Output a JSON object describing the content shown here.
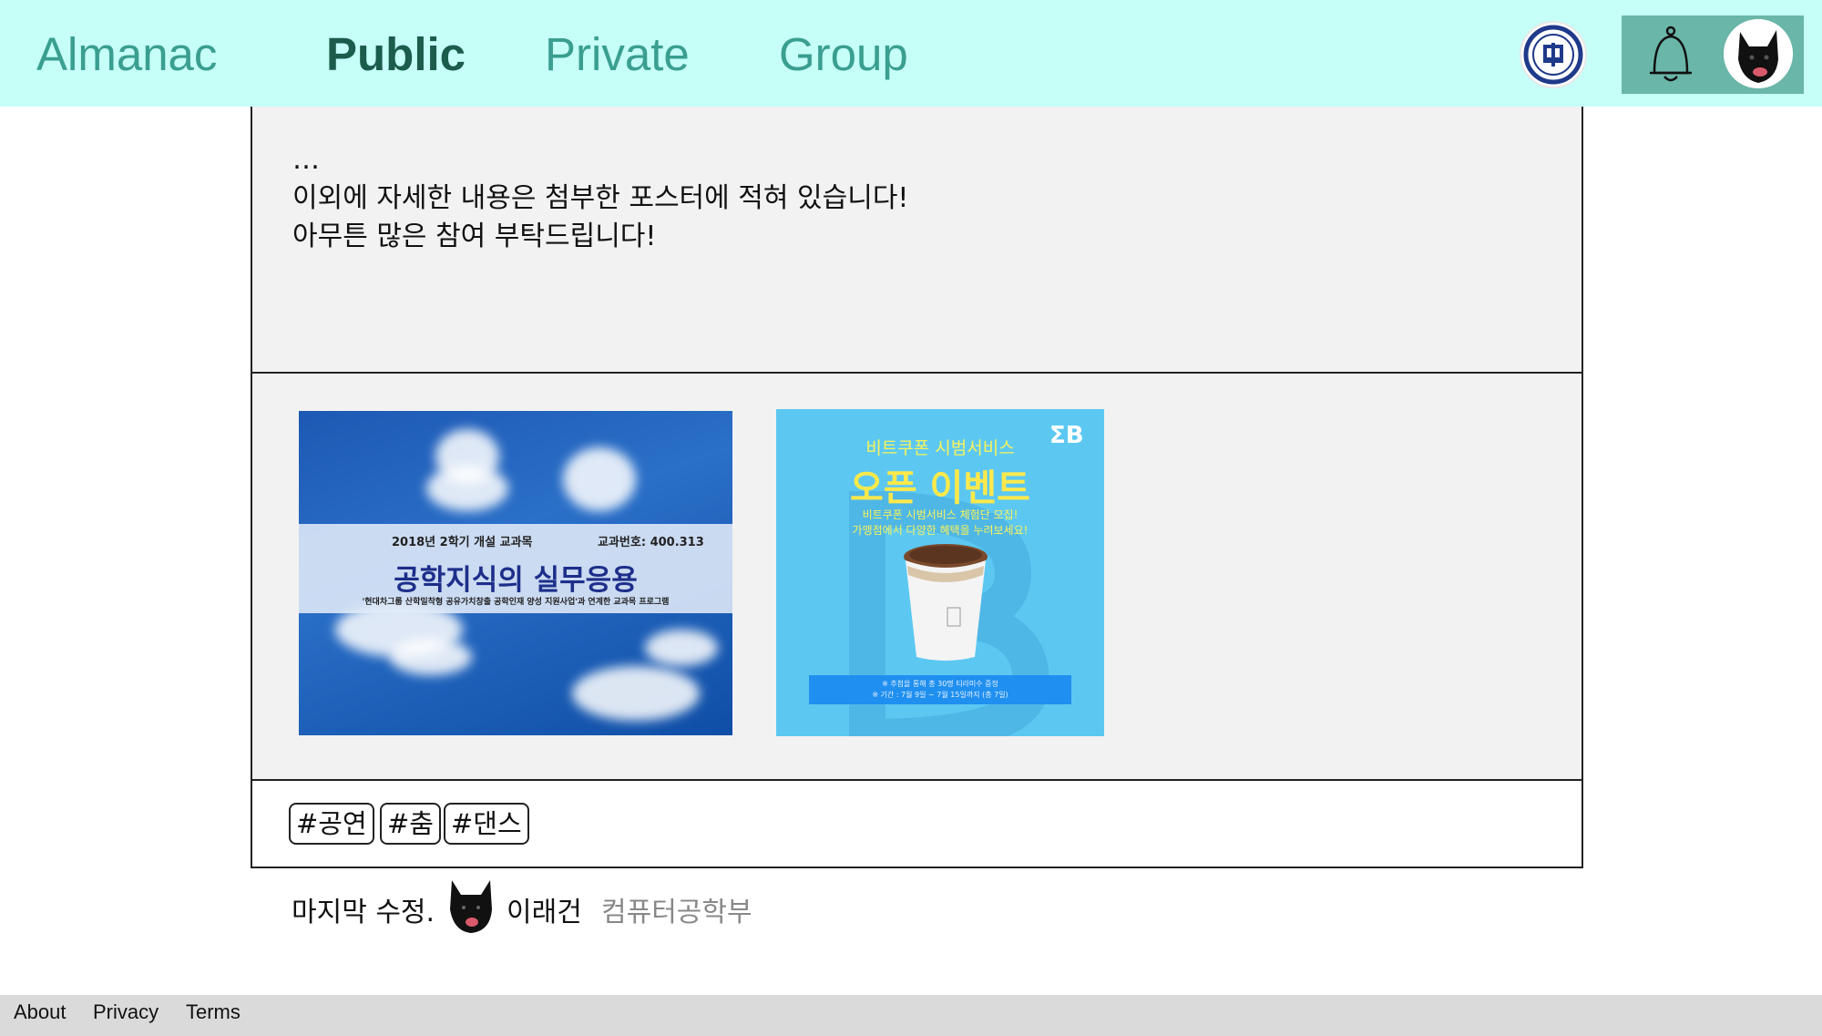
{
  "header": {
    "brand": "Almanac",
    "nav": {
      "public": "Public",
      "private": "Private",
      "group": "Group"
    },
    "active_tab": "Public"
  },
  "post": {
    "body_lines": "…\n이외에 자세한 내용은 첨부한 포스터에 적혀 있습니다!\n아무튼 많은 참여 부탁드립니다!",
    "attachments": {
      "poster1": {
        "line1_left": "2018년 2학기 개설 교과목",
        "line1_right": "교과번호: 400.313",
        "title": "공학지식의 실무응용",
        "subtitle": "'현대차그룹 산학밀착형 공유가치창출 공학인재 양성 지원사업'과 연계한 교과목 프로그램"
      },
      "poster2": {
        "small_title": "비트쿠폰 시범서비스",
        "big_title": "오픈 이벤트",
        "desc": "비트쿠폰 시범서비스 체험단 모집!\n가맹점에서 다양한 혜택을 누려보세요!",
        "logo": "ΣB",
        "strip": "※ 추첨을 통해 총 30명 티라미수 증정\n※ 기간 : 7월 9일 ~ 7월 15일까지 (총 7일)"
      }
    },
    "tags": [
      "#공연",
      "#춤",
      "#댄스"
    ],
    "meta": {
      "label": "마지막 수정.",
      "author": "이래건",
      "department": "컴퓨터공학부"
    }
  },
  "footer": {
    "about": "About",
    "privacy": "Privacy",
    "terms": "Terms"
  },
  "colors": {
    "header_bg": "#c5fff8",
    "accent": "#3a9e90",
    "active": "#1c5c4c",
    "user_box": "#6ab6a8"
  }
}
